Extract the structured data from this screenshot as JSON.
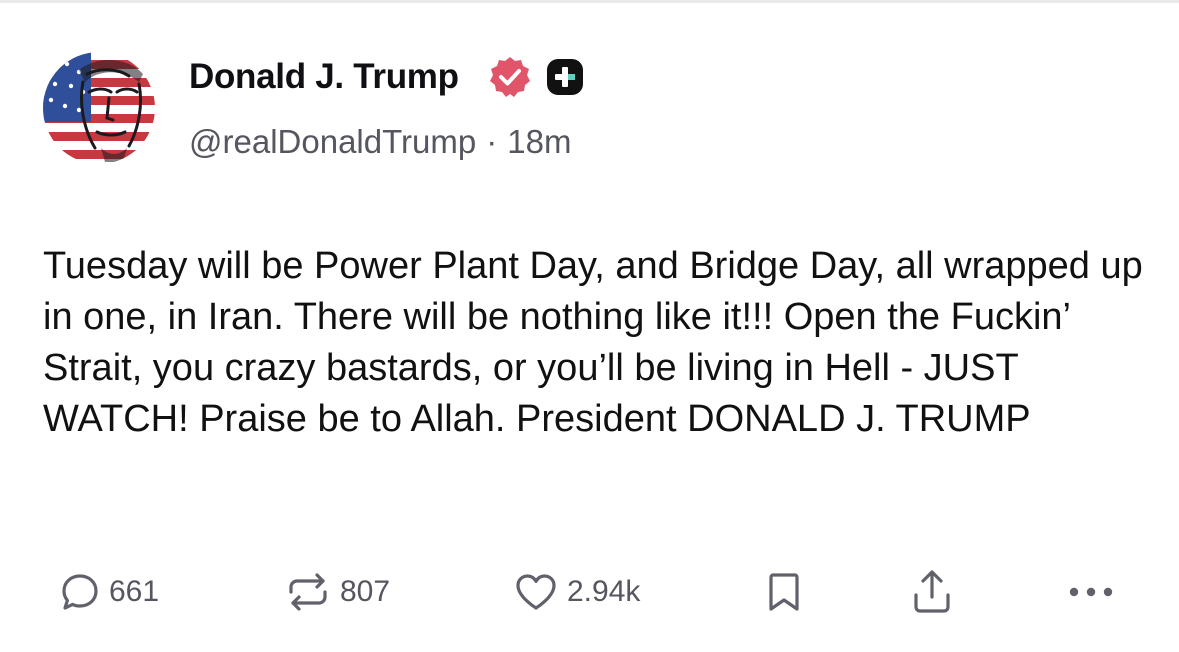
{
  "author": {
    "name": "Donald J. Trump",
    "handle": "@realDonaldTrump",
    "separator": "·",
    "time": "18m",
    "verified_icon": "verified-badge-icon",
    "verified_color": "#e0556a",
    "extra_badge_icon": "plus-badge-icon"
  },
  "post": {
    "text": "Tuesday will be Power Plant Day, and Bridge Day, all wrapped up in one, in Iran. There will be nothing like it!!! Open the Fuckin’ Strait, you crazy bastards, or you’ll be living in Hell - JUST WATCH! Praise be to Allah. President DONALD J. TRUMP"
  },
  "actions": {
    "replies": {
      "icon": "reply-icon",
      "count": "661"
    },
    "retruths": {
      "icon": "repost-icon",
      "count": "807"
    },
    "likes": {
      "icon": "heart-icon",
      "count": "2.94k"
    },
    "bookmark": {
      "icon": "bookmark-icon"
    },
    "share": {
      "icon": "share-icon"
    },
    "more": {
      "icon": "more-icon"
    }
  },
  "colors": {
    "text": "#111111",
    "muted": "#55565f",
    "icon": "#60616b"
  }
}
